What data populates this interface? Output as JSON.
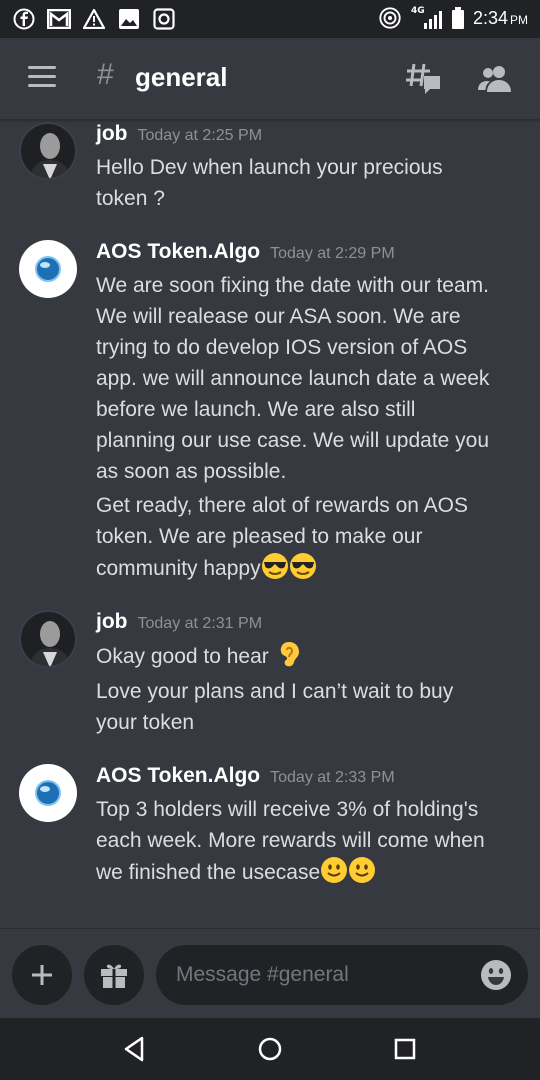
{
  "status_bar": {
    "time": "2:34",
    "ampm": "PM",
    "network": "4G",
    "icons": [
      "facebook-icon",
      "gmail-icon",
      "warning-icon",
      "image-icon",
      "instagram-icon",
      "hotspot-icon",
      "signal-icon",
      "battery-icon"
    ]
  },
  "header": {
    "hash": "#",
    "channel": "general",
    "icons": [
      "menu-icon",
      "threads-icon",
      "members-icon"
    ]
  },
  "messages": [
    {
      "author": "job",
      "timestamp": "Today at 2:25 PM",
      "lines": [
        "Hello Dev when launch your precious",
        "token ?"
      ]
    },
    {
      "author": "AOS Token.Algo",
      "timestamp": "Today at 2:29 PM",
      "lines": [
        "We are soon fixing the date with our team.",
        "We will realease our ASA soon. We are",
        "trying to do develop IOS version of AOS",
        "app. we will announce launch date a week",
        "before we launch. We are also still",
        "planning our use case. We will update you",
        "as soon as possible."
      ],
      "lines2": [
        "Get ready, there alot of rewards on AOS",
        "token. We are pleased to make our",
        "community happy"
      ]
    },
    {
      "author": "job",
      "timestamp": "Today at 2:31 PM",
      "lines": [
        "Okay good to hear"
      ],
      "lines2": [
        "Love your plans and I can’t wait to buy",
        "your token"
      ]
    },
    {
      "author": "AOS Token.Algo",
      "timestamp": "Today at 2:33 PM",
      "lines": [
        "Top 3 holders will receive 3% of holding's",
        "each week. More rewards will come when",
        "we finished the usecase"
      ]
    }
  ],
  "composer": {
    "placeholder": "Message #general"
  },
  "colors": {
    "background": "#36393f",
    "dark": "#202225",
    "text": "#dcddde",
    "muted": "#8e9297"
  }
}
